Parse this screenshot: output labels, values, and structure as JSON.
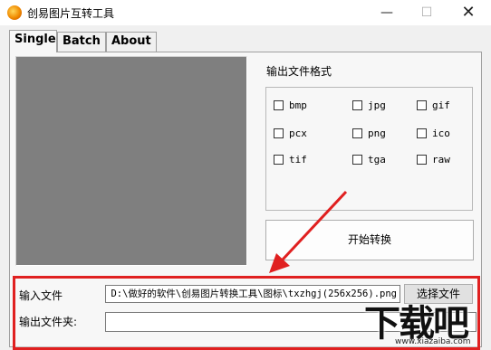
{
  "window": {
    "title": "创易图片互转工具",
    "minimize": "—",
    "maximize": "☐",
    "close": "✕"
  },
  "tabs": [
    "Single",
    "Batch",
    "About"
  ],
  "format_section": {
    "label": "输出文件格式",
    "formats": [
      "bmp",
      "jpg",
      "gif",
      "pcx",
      "png",
      "ico",
      "tif",
      "tga",
      "raw"
    ]
  },
  "convert_button": "开始转换",
  "input_file": {
    "label": "输入文件",
    "value": "D:\\做好的软件\\创易图片转换工具\\图标\\txzhgj(256x256).png",
    "choose_button": "选择文件"
  },
  "output_folder": {
    "label": "输出文件夹:",
    "value": ""
  },
  "watermark": {
    "text": "下载吧",
    "url": "www.xiazaiba.com"
  },
  "colors": {
    "highlight": "#e02020",
    "preview_bg": "#7f7f7f"
  }
}
